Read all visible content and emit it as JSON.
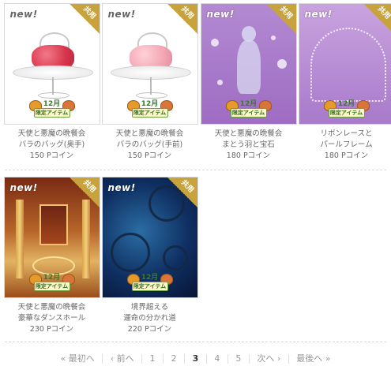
{
  "items": [
    {
      "name_line1": "天使と悪魔の晩餐会",
      "name_line2": "バラのバッグ(奥手)",
      "price": "150 Pコイン",
      "new_label": "new!",
      "corner_label": "共用",
      "badge_month": "12月",
      "badge_text": "限定アイテム"
    },
    {
      "name_line1": "天使と悪魔の晩餐会",
      "name_line2": "バラのバッグ(手前)",
      "price": "150 Pコイン",
      "new_label": "new!",
      "corner_label": "共用",
      "badge_month": "12月",
      "badge_text": "限定アイテム"
    },
    {
      "name_line1": "天使と悪魔の晩餐会",
      "name_line2": "まとう羽と宝石",
      "price": "180 Pコイン",
      "new_label": "new!",
      "corner_label": "共用",
      "badge_month": "12月",
      "badge_text": "限定アイテム"
    },
    {
      "name_line1": "リボンレースと",
      "name_line2": "パールフレーム",
      "price": "180 Pコイン",
      "new_label": "new!",
      "corner_label": "共用",
      "badge_month": "12月",
      "badge_text": "限定アイテム"
    },
    {
      "name_line1": "天使と悪魔の晩餐会",
      "name_line2": "豪華なダンスホール",
      "price": "230 Pコイン",
      "new_label": "new!",
      "corner_label": "共用",
      "badge_month": "12月",
      "badge_text": "限定アイテム"
    },
    {
      "name_line1": "境界超える",
      "name_line2": "運命の分かれ道",
      "price": "220 Pコイン",
      "new_label": "new!",
      "corner_label": "共用",
      "badge_month": "12月",
      "badge_text": "限定アイテム"
    }
  ],
  "pagination": {
    "first": "« 最初へ",
    "prev": "‹ 前へ",
    "pages": [
      "1",
      "2",
      "3",
      "4",
      "5"
    ],
    "current": "3",
    "next": "次へ ›",
    "last": "最後へ »"
  },
  "colors": {
    "corner": "#c8a23c",
    "text": "#666666"
  }
}
